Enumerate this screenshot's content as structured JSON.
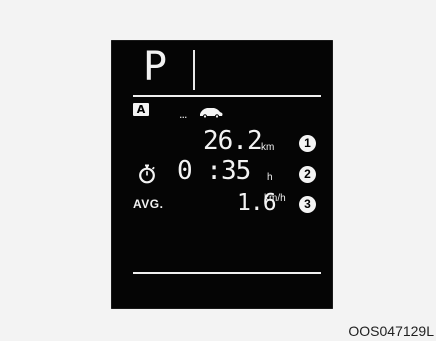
{
  "display": {
    "gear": "P",
    "mode_badge": "A",
    "dots": "...",
    "distance": {
      "value": "26.2",
      "unit": "km",
      "marker": "1"
    },
    "time": {
      "value": "0 :35",
      "unit": "h",
      "marker": "2"
    },
    "average_speed": {
      "label": "AVG.",
      "value": "1.6",
      "unit": "km/h",
      "marker": "3"
    }
  },
  "image_code": "OOS047129L",
  "icons": {
    "car": "car-icon",
    "stopwatch": "stopwatch-icon"
  },
  "colors": {
    "screen_background": "#050505",
    "display_foreground": "#f3f3f3",
    "page_background": "#f3f3f3"
  }
}
